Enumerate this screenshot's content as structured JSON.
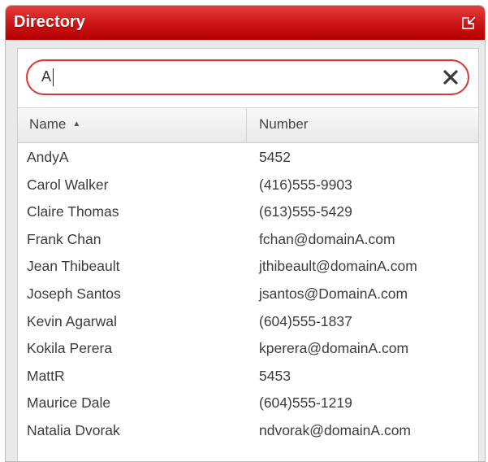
{
  "window": {
    "title": "Directory",
    "popout_icon": "popout-icon"
  },
  "search": {
    "value": "A",
    "clear_icon": "close-icon"
  },
  "table": {
    "columns": {
      "name": "Name",
      "number": "Number",
      "sort_icon": "sort-ascending-icon"
    },
    "rows": [
      {
        "name": "AndyA",
        "number": "5452"
      },
      {
        "name": "Carol Walker",
        "number": "(416)555-9903"
      },
      {
        "name": "Claire Thomas",
        "number": "(613)555-5429"
      },
      {
        "name": "Frank Chan",
        "number": "fchan@domainA.com"
      },
      {
        "name": "Jean Thibeault",
        "number": "jthibeault@domainA.com"
      },
      {
        "name": "Joseph Santos",
        "number": "jsantos@DomainA.com"
      },
      {
        "name": "Kevin Agarwal",
        "number": "(604)555-1837"
      },
      {
        "name": "Kokila Perera",
        "number": "kperera@domainA.com"
      },
      {
        "name": "MattR",
        "number": "5453"
      },
      {
        "name": "Maurice Dale",
        "number": "(604)555-1219"
      },
      {
        "name": "Natalia Dvorak",
        "number": "ndvorak@domainA.com"
      }
    ]
  },
  "colors": {
    "title_bar": "#cc1414",
    "search_border": "#d23a3a"
  }
}
